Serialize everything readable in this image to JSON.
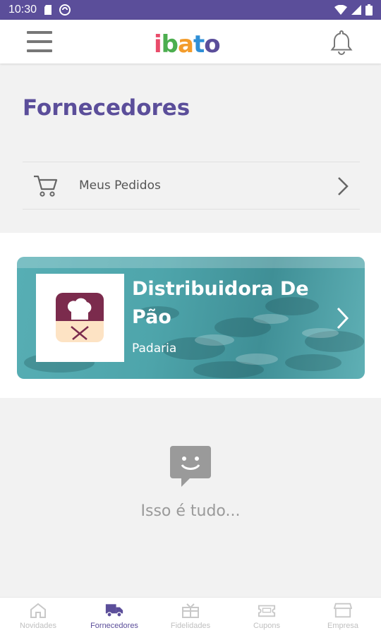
{
  "status_bar": {
    "time": "10:30"
  },
  "header": {
    "logo_text": [
      "i",
      "b",
      "a",
      "t",
      "o"
    ],
    "logo_colors": [
      "#e94b6a",
      "#4cae4f",
      "#f39c2b",
      "#2f8fd6",
      "#5b4e9a"
    ]
  },
  "page": {
    "title": "Fornecedores"
  },
  "orders": {
    "label": "Meus Pedidos"
  },
  "suppliers": [
    {
      "name": "Distribuidora De Pão",
      "category": "Padaria"
    }
  ],
  "empty_state": {
    "message": "Isso é tudo..."
  },
  "bottom_nav": {
    "items": [
      {
        "label": "Novidades",
        "icon": "home-icon",
        "active": false
      },
      {
        "label": "Fornecedores",
        "icon": "truck-icon",
        "active": true
      },
      {
        "label": "Fidelidades",
        "icon": "gift-icon",
        "active": false
      },
      {
        "label": "Cupons",
        "icon": "ticket-icon",
        "active": false
      },
      {
        "label": "Empresa",
        "icon": "store-icon",
        "active": false
      }
    ]
  },
  "colors": {
    "primary": "#5b4e9a",
    "card_teal": "#4ea5ab",
    "muted": "#9a9a9a"
  }
}
